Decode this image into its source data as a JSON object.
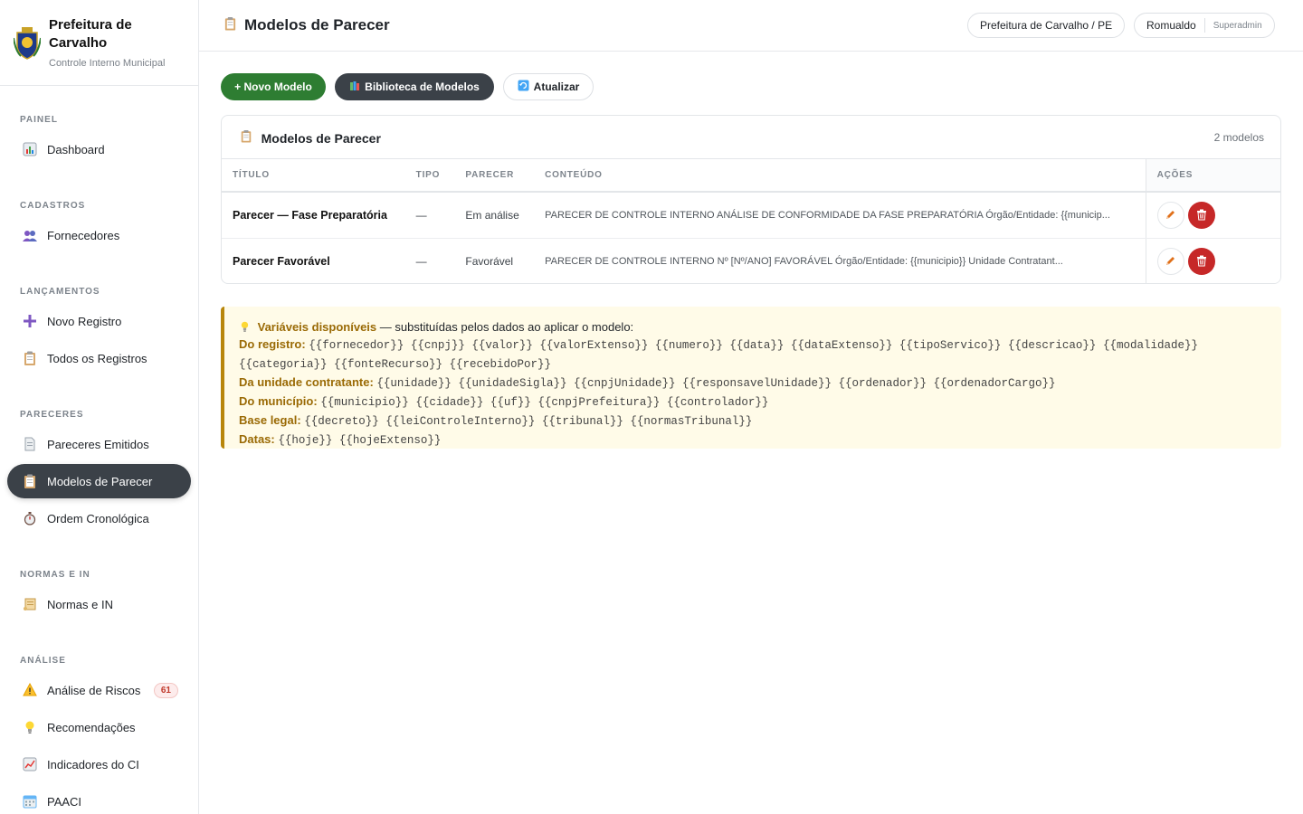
{
  "brand": {
    "name": "Prefeitura de Carvalho",
    "subtitle": "Controle Interno Municipal"
  },
  "sidebar": {
    "sections": [
      {
        "title": "PAINEL",
        "items": [
          {
            "label": "Dashboard",
            "icon": "chart-icon"
          }
        ]
      },
      {
        "title": "CADASTROS",
        "items": [
          {
            "label": "Fornecedores",
            "icon": "people-icon"
          }
        ]
      },
      {
        "title": "LANÇAMENTOS",
        "items": [
          {
            "label": "Novo Registro",
            "icon": "plus-icon"
          },
          {
            "label": "Todos os Registros",
            "icon": "clipboard-icon"
          }
        ]
      },
      {
        "title": "PARECERES",
        "items": [
          {
            "label": "Pareceres Emitidos",
            "icon": "document-icon"
          },
          {
            "label": "Modelos de Parecer",
            "icon": "clipboard-icon",
            "active": true
          },
          {
            "label": "Ordem Cronológica",
            "icon": "stopwatch-icon"
          }
        ]
      },
      {
        "title": "NORMAS E IN",
        "items": [
          {
            "label": "Normas e IN",
            "icon": "scroll-icon"
          }
        ]
      },
      {
        "title": "ANÁLISE",
        "items": [
          {
            "label": "Análise de Riscos",
            "icon": "warning-icon",
            "badge": "61"
          },
          {
            "label": "Recomendações",
            "icon": "lightbulb-icon"
          },
          {
            "label": "Indicadores do CI",
            "icon": "trend-icon"
          },
          {
            "label": "PAACI",
            "icon": "calendar-icon"
          }
        ]
      }
    ]
  },
  "header": {
    "title": "Modelos de Parecer",
    "municipality": "Prefeitura de Carvalho / PE",
    "user": "Romualdo",
    "role": "Superadmin"
  },
  "toolbar": {
    "new_label": "+ Novo Modelo",
    "library_label": "Biblioteca de Modelos",
    "refresh_label": "Atualizar"
  },
  "card": {
    "title": "Modelos de Parecer",
    "count": "2 modelos",
    "columns": [
      "TÍTULO",
      "TIPO",
      "PARECER",
      "CONTEÚDO",
      "AÇÕES"
    ],
    "rows": [
      {
        "titulo": "Parecer — Fase Preparatória",
        "tipo": "—",
        "parecer": "Em análise",
        "conteudo": "PARECER DE CONTROLE INTERNO ANÁLISE DE CONFORMIDADE DA FASE PREPARATÓRIA Órgão/Entidade: {{municip..."
      },
      {
        "titulo": "Parecer Favorável",
        "tipo": "—",
        "parecer": "Favorável",
        "conteudo": "PARECER DE CONTROLE INTERNO Nº [Nº/ANO] FAVORÁVEL Órgão/Entidade: {{municipio}} Unidade Contratant..."
      }
    ]
  },
  "variables": {
    "heading": "Variáveis disponíveis",
    "intro": " — substituídas pelos dados ao aplicar o modelo:",
    "groups": [
      {
        "label": "Do registro:",
        "vars": "{{fornecedor}} {{cnpj}} {{valor}} {{valorExtenso}} {{numero}} {{data}} {{dataExtenso}} {{tipoServico}} {{descricao}} {{modalidade}} {{categoria}} {{fonteRecurso}} {{recebidoPor}}"
      },
      {
        "label": "Da unidade contratante:",
        "vars": "{{unidade}} {{unidadeSigla}} {{cnpjUnidade}} {{responsavelUnidade}} {{ordenador}} {{ordenadorCargo}}"
      },
      {
        "label": "Do município:",
        "vars": "{{municipio}} {{cidade}} {{uf}} {{cnpjPrefeitura}} {{controlador}}"
      },
      {
        "label": "Base legal:",
        "vars": "{{decreto}} {{leiControleInterno}} {{tribunal}} {{normasTribunal}}"
      },
      {
        "label": "Datas:",
        "vars": "{{hoje}} {{hojeExtenso}}"
      }
    ]
  },
  "colors": {
    "active_nav": "#3b4148",
    "primary_green": "#2e7d32",
    "danger_red": "#c62828",
    "warning_label": "#9a6a05"
  }
}
